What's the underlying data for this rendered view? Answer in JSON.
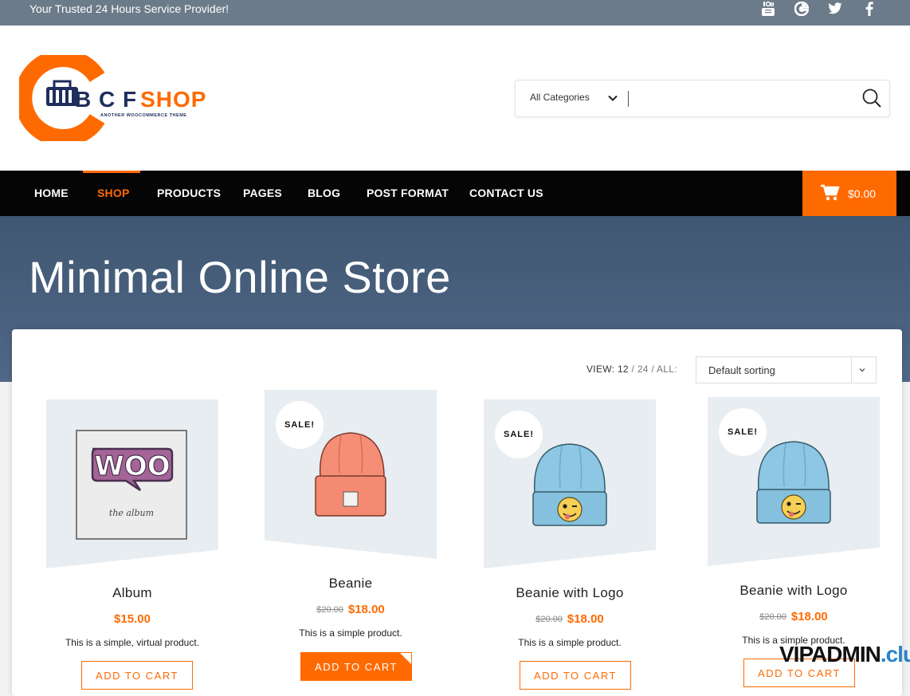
{
  "topbar": {
    "tagline": "Your Trusted 24 Hours Service Provider!",
    "social_icons": [
      "youtube-icon",
      "google-icon",
      "twitter-icon",
      "facebook-icon"
    ]
  },
  "logo": {
    "name_part1": "B C F",
    "name_part2": "SHOP",
    "subtitle": "ANOTHER WOOCOMMERCE THEME"
  },
  "search": {
    "category": "All Categories",
    "placeholder": ""
  },
  "nav": {
    "items": [
      "HOME",
      "SHOP",
      "PRODUCTS",
      "PAGES",
      "BLOG",
      "POST FORMAT",
      "CONTACT US"
    ],
    "active": "SHOP"
  },
  "cart": {
    "total": "$0.00"
  },
  "hero": {
    "title": "Minimal Online Store"
  },
  "toolbar": {
    "view_label": "VIEW:",
    "view_options": [
      "12",
      "24",
      "ALL:"
    ],
    "view_sep": "/",
    "sorting": "Default sorting"
  },
  "products": [
    {
      "name": "Album",
      "price": "$15.00",
      "old_price": "",
      "sale_badge": "",
      "description": "This is a simple, virtual product.",
      "button": "ADD TO CART",
      "image": "woo-album-image",
      "image_text_main": "WOO",
      "image_text_sub": "the album"
    },
    {
      "name": "Beanie",
      "price": "$18.00",
      "old_price": "$20.00",
      "sale_badge": "SALE!",
      "description": "This is a simple product.",
      "button": "ADD TO CART",
      "image": "orange-beanie-image"
    },
    {
      "name": "Beanie with Logo",
      "price": "$18.00",
      "old_price": "$20.00",
      "sale_badge": "SALE!",
      "description": "This is a simple product.",
      "button": "ADD TO CART",
      "image": "blue-beanie-logo-image"
    },
    {
      "name": "Beanie with Logo",
      "price": "$18.00",
      "old_price": "$20.00",
      "sale_badge": "SALE!",
      "description": "This is a simple product.",
      "button": "ADD TO CART",
      "image": "blue-beanie-logo-image"
    }
  ],
  "watermark": {
    "part1": "VIPADMIN",
    "part2": ".club"
  },
  "colors": {
    "accent": "#ff6a00",
    "topbar": "#6c7b8a",
    "nav": "#050505",
    "hero": "#465e7a",
    "brand_navy": "#1e2e5c"
  }
}
